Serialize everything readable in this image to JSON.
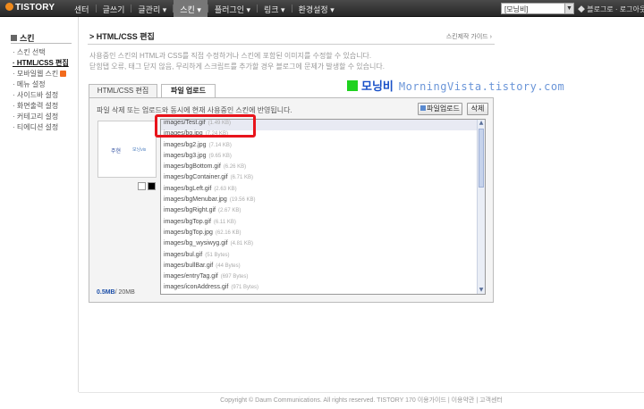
{
  "app": {
    "logo": "TISTORY"
  },
  "nav": {
    "items": [
      "센터",
      "글쓰기",
      "글관리 ▾",
      "스킨 ▾",
      "플러그인 ▾",
      "링크 ▾",
      "환경설정 ▾"
    ],
    "active_index": 3
  },
  "blog_select": {
    "value": "[모닝비]"
  },
  "top_links": "◆ 블로그로 · 로그아웃",
  "sidebar": {
    "title": "스킨",
    "items": [
      "· 스킨 선택",
      "· HTML/CSS 편집",
      "· 모바일웹 스킨",
      "· 메뉴 설정",
      "· 사이드바 설정",
      "· 화면출력 설정",
      "· 커테고리 설정",
      "· 티에디션 설정"
    ],
    "current_index": 1,
    "new_badge_index": 2
  },
  "main": {
    "title": "> HTML/CSS 편집",
    "guide_link": "스킨제작 가이드 ›",
    "desc_line1": "사용중인 스킨의 HTML과 CSS를 직접 수정하거나 스킨에 포함된 이미지를 수정할 수 있습니다.",
    "desc_line2": "닫힘탭 오류, 태그 닫지 않음, 무리하게 스크립트를 추가할 경우 블로그에 문제가 발생할 수 있습니다."
  },
  "tabs": [
    {
      "label": "HTML/CSS 편집"
    },
    {
      "label": "파일 업로드"
    }
  ],
  "active_tab_index": 1,
  "watermark": {
    "korean": "모닝비",
    "english": "MorningVista.tistory.com",
    "box_color": "#1fd21f"
  },
  "panel": {
    "info": "파일 삭제 또는 업로드와 동시에 현재 사용중인 스킨에 반영됩니다.",
    "upload_button": "파일업로드",
    "delete_button": "삭제",
    "preview_text_a": "주현",
    "preview_text_b": "모닝vis",
    "usage_used": "0.5MB",
    "usage_total": "/ 20MB",
    "files": [
      {
        "name": "images/Test.gif",
        "size": "(1.49 KB)"
      },
      {
        "name": "images/bg.jpg",
        "size": "(7.24 KB)"
      },
      {
        "name": "images/bg2.jpg",
        "size": "(7.14 KB)"
      },
      {
        "name": "images/bg3.jpg",
        "size": "(9.65 KB)"
      },
      {
        "name": "images/bgBottom.gif",
        "size": "(6.26 KB)"
      },
      {
        "name": "images/bgContainer.gif",
        "size": "(6.71 KB)"
      },
      {
        "name": "images/bgLeft.gif",
        "size": "(2.63 KB)"
      },
      {
        "name": "images/bgMenubar.jpg",
        "size": "(19.56 KB)"
      },
      {
        "name": "images/bgRight.gif",
        "size": "(2.67 KB)"
      },
      {
        "name": "images/bgTop.gif",
        "size": "(6.11 KB)"
      },
      {
        "name": "images/bgTop.jpg",
        "size": "(62.16 KB)"
      },
      {
        "name": "images/bg_wysiwyg.gif",
        "size": "(4.81 KB)"
      },
      {
        "name": "images/bul.gif",
        "size": "(51 Bytes)"
      },
      {
        "name": "images/bullBar.gif",
        "size": "(44 Bytes)"
      },
      {
        "name": "images/entryTag.gif",
        "size": "(697 Bytes)"
      },
      {
        "name": "images/iconAddress.gif",
        "size": "(971 Bytes)"
      }
    ],
    "selected_index": 0
  },
  "footer": "Copyright © Daum Communications. All rights reserved. TISTORY 170  이용가이드 | 이용약관 | 고객센터",
  "colors": {
    "highlight": "#e8141b",
    "accent": "#1d4fa8"
  }
}
